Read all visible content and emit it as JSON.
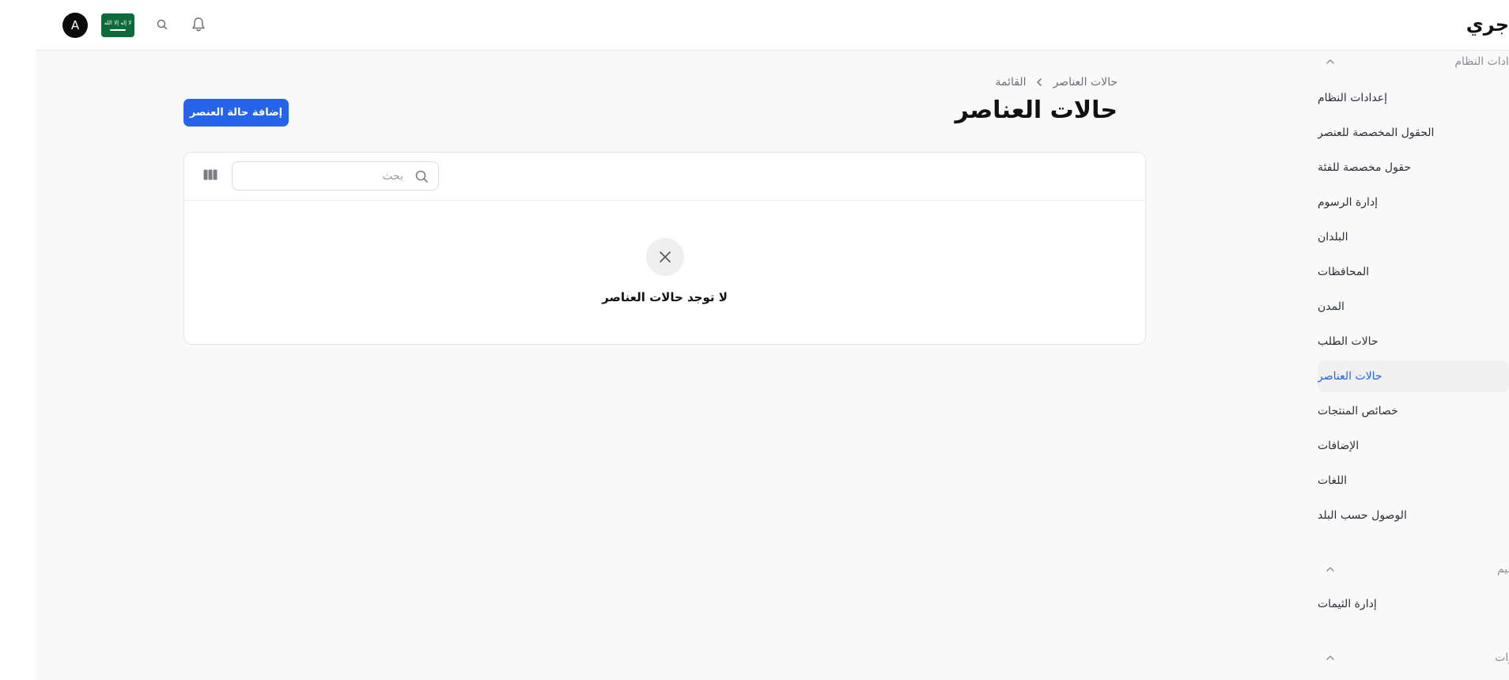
{
  "topbar": {
    "brand": "جري",
    "avatar_initial": "A",
    "flag_script": "لا إله إلا الله",
    "icons": [
      "bell-icon",
      "search-icon",
      "saudi-flag-icon",
      "avatar"
    ]
  },
  "header": {
    "breadcrumb": [
      "حالات العناصر",
      "القائمة"
    ],
    "title": "حالات العناصر",
    "add_button": "إضافة حالة العنصر"
  },
  "table": {
    "search_placeholder": "بحث",
    "empty_message": "لا توجد حالات العناصر"
  },
  "sidebar": {
    "groups": [
      {
        "label": "دادات النظام",
        "items": [
          "إعدادات النظام",
          "الحقول المخصصة للعنصر",
          "حقول مخصصة للفئة",
          "إدارة الرسوم",
          "البلدان",
          "المحافظات",
          "المدن",
          "حالات الطلب",
          "حالات العناصر",
          "خصائص المنتجات",
          "الإضافات",
          "اللغات",
          "الوصول حسب البلد"
        ]
      },
      {
        "label": "ميم",
        "items": [
          "إدارة الثيمات"
        ]
      },
      {
        "label": "وات",
        "items": []
      }
    ],
    "active_item": "حالات العناصر"
  },
  "colors": {
    "accent": "#2563eb",
    "flag_green": "#0b6b3a",
    "content_bg": "#f9f9f9",
    "active_bg": "#f0f0f0"
  }
}
